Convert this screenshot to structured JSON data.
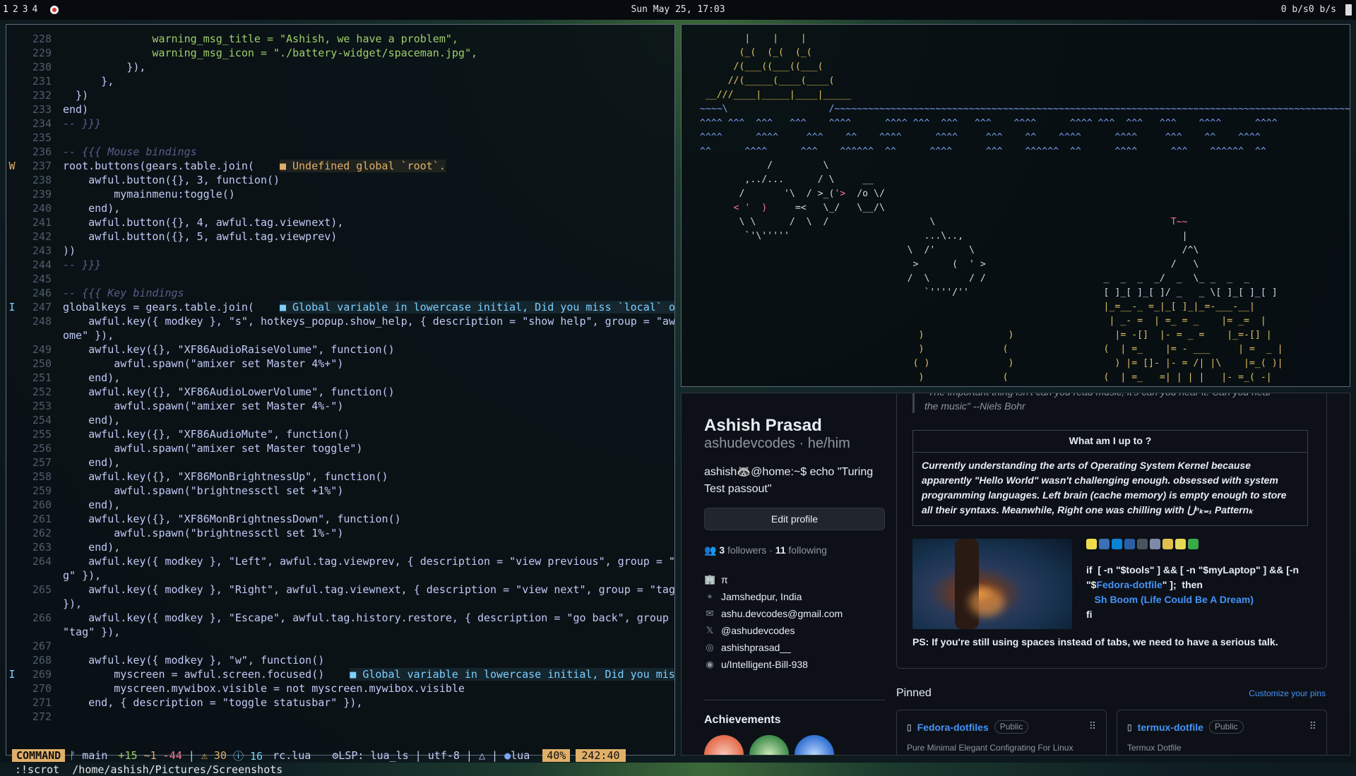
{
  "topbar": {
    "tags": [
      "1",
      "2",
      "3",
      "4"
    ],
    "clock": "Sun May 25, 17:03",
    "net": "0 b/s0 b/s"
  },
  "editor": {
    "lines": [
      {
        "n": "228",
        "sign": "",
        "t": "              warning_msg_title = \"Ashish, we have a problem\",",
        "cls": "c-str"
      },
      {
        "n": "229",
        "sign": "",
        "t": "              warning_msg_icon = \"./battery-widget/spaceman.jpg\",",
        "cls": "c-str"
      },
      {
        "n": "230",
        "sign": "",
        "t": "          }),",
        "cls": ""
      },
      {
        "n": "231",
        "sign": "",
        "t": "      },",
        "cls": ""
      },
      {
        "n": "232",
        "sign": "",
        "t": "  })",
        "cls": ""
      },
      {
        "n": "233",
        "sign": "",
        "t": "end)",
        "cls": ""
      },
      {
        "n": "234",
        "sign": "",
        "t": "-- }}}",
        "cls": "c-com"
      },
      {
        "n": "235",
        "sign": "",
        "t": "",
        "cls": ""
      },
      {
        "n": "236",
        "sign": "",
        "t": "-- {{{ Mouse bindings",
        "cls": "c-com"
      },
      {
        "n": "237",
        "sign": "W",
        "t": "root.buttons(gears.table.join(",
        "cls": "",
        "diag": "■ Undefined global `root`.",
        "dcls": "c-warn"
      },
      {
        "n": "238",
        "sign": "",
        "t": "    awful.button({}, 3, function()",
        "cls": ""
      },
      {
        "n": "239",
        "sign": "",
        "t": "        mymainmenu:toggle()",
        "cls": ""
      },
      {
        "n": "240",
        "sign": "",
        "t": "    end),",
        "cls": ""
      },
      {
        "n": "241",
        "sign": "",
        "t": "    awful.button({}, 4, awful.tag.viewnext),",
        "cls": ""
      },
      {
        "n": "242",
        "sign": "",
        "t": "    awful.button({}, 5, awful.tag.viewprev)",
        "cls": ""
      },
      {
        "n": "243",
        "sign": "",
        "t": "))",
        "cls": ""
      },
      {
        "n": "244",
        "sign": "",
        "t": "-- }}}",
        "cls": "c-com"
      },
      {
        "n": "245",
        "sign": "",
        "t": "",
        "cls": ""
      },
      {
        "n": "246",
        "sign": "",
        "t": "-- {{{ Key bindings",
        "cls": "c-com"
      },
      {
        "n": "247",
        "sign": "I",
        "t": "globalkeys = gears.table.join(",
        "cls": "",
        "diag": "■ Global variable in lowercase initial, Did you miss `local` or",
        "dcls": "c-info"
      },
      {
        "n": "248",
        "sign": "",
        "t": "    awful.key({ modkey }, \"s\", hotkeys_popup.show_help, { description = \"show help\", group = \"awes",
        "cls": ""
      },
      {
        "n": "",
        "sign": "",
        "t": "ome\" }),",
        "cls": ""
      },
      {
        "n": "249",
        "sign": "",
        "t": "    awful.key({}, \"XF86AudioRaiseVolume\", function()",
        "cls": ""
      },
      {
        "n": "250",
        "sign": "",
        "t": "        awful.spawn(\"amixer set Master 4%+\")",
        "cls": ""
      },
      {
        "n": "251",
        "sign": "",
        "t": "    end),",
        "cls": ""
      },
      {
        "n": "252",
        "sign": "",
        "t": "    awful.key({}, \"XF86AudioLowerVolume\", function()",
        "cls": ""
      },
      {
        "n": "253",
        "sign": "",
        "t": "        awful.spawn(\"amixer set Master 4%-\")",
        "cls": ""
      },
      {
        "n": "254",
        "sign": "",
        "t": "    end),",
        "cls": ""
      },
      {
        "n": "255",
        "sign": "",
        "t": "    awful.key({}, \"XF86AudioMute\", function()",
        "cls": ""
      },
      {
        "n": "256",
        "sign": "",
        "t": "        awful.spawn(\"amixer set Master toggle\")",
        "cls": ""
      },
      {
        "n": "257",
        "sign": "",
        "t": "    end),",
        "cls": ""
      },
      {
        "n": "258",
        "sign": "",
        "t": "    awful.key({}, \"XF86MonBrightnessUp\", function()",
        "cls": ""
      },
      {
        "n": "259",
        "sign": "",
        "t": "        awful.spawn(\"brightnessctl set +1%\")",
        "cls": ""
      },
      {
        "n": "260",
        "sign": "",
        "t": "    end),",
        "cls": ""
      },
      {
        "n": "261",
        "sign": "",
        "t": "    awful.key({}, \"XF86MonBrightnessDown\", function()",
        "cls": ""
      },
      {
        "n": "262",
        "sign": "",
        "t": "        awful.spawn(\"brightnessctl set 1%-\")",
        "cls": ""
      },
      {
        "n": "263",
        "sign": "",
        "t": "    end),",
        "cls": ""
      },
      {
        "n": "264",
        "sign": "",
        "t": "    awful.key({ modkey }, \"Left\", awful.tag.viewprev, { description = \"view previous\", group = \"ta",
        "cls": ""
      },
      {
        "n": "",
        "sign": "",
        "t": "g\" }),",
        "cls": ""
      },
      {
        "n": "265",
        "sign": "",
        "t": "    awful.key({ modkey }, \"Right\", awful.tag.viewnext, { description = \"view next\", group = \"tag\"",
        "cls": ""
      },
      {
        "n": "",
        "sign": "",
        "t": "}),",
        "cls": ""
      },
      {
        "n": "266",
        "sign": "",
        "t": "    awful.key({ modkey }, \"Escape\", awful.tag.history.restore, { description = \"go back\", group =",
        "cls": ""
      },
      {
        "n": "",
        "sign": "",
        "t": "\"tag\" }),",
        "cls": ""
      },
      {
        "n": "267",
        "sign": "",
        "t": "",
        "cls": ""
      },
      {
        "n": "268",
        "sign": "",
        "t": "    awful.key({ modkey }, \"w\", function()",
        "cls": ""
      },
      {
        "n": "269",
        "sign": "I",
        "t": "        myscreen = awful.screen.focused()",
        "cls": "",
        "diag": "■ Global variable in lowercase initial, Did you miss",
        "dcls": "c-info"
      },
      {
        "n": "270",
        "sign": "",
        "t": "        myscreen.mywibox.visible = not myscreen.mywibox.visible",
        "cls": ""
      },
      {
        "n": "271",
        "sign": "",
        "t": "    end, { description = \"toggle statusbar\" }),",
        "cls": ""
      },
      {
        "n": "272",
        "sign": "",
        "t": "",
        "cls": ""
      }
    ],
    "status": {
      "mode": "COMMAND",
      "branch": " main ",
      "added": "+15",
      "changed": "~1",
      "deleted": "-44",
      "warnings": "⚠ 30",
      "infos": "ⓘ 16",
      "file": "rc.lua",
      "lsp": "LSP: lua_ls",
      "encoding": "utf-8",
      "filetype": "lua",
      "percent": "40%",
      "position": "242:40"
    },
    "cmdline": ":!scrot  /home/ashish/Pictures/Screenshots"
  },
  "ascii": {
    "rows": [
      [
        [
          "a-y",
          "          |    |    |"
        ]
      ],
      [
        [
          "a-y",
          "         (_(  (_(  (_("
        ]
      ],
      [
        [
          "a-y",
          "        /(___((___((___("
        ]
      ],
      [
        [
          "a-y",
          "       //(_____(____(____("
        ]
      ],
      [
        [
          "a-y",
          "   __///____|_____|____|_____"
        ]
      ],
      [
        [
          "a-b",
          "  ~~~~\\                  /~~~~~~~~~~~~~~~~~~~~~~~~~~~~~~~~~~~~~~~~~~~~~~~~~~~~~~~~~~~~~~~~~~~~~~~~~~~~~~~~~~~~~~~~~~~~~~~~~~~~"
        ]
      ],
      [
        [
          "a-b",
          "  ^^^^ ^^^  ^^^   ^^^    ^^^^      ^^^^ ^^^  ^^^   ^^^    ^^^^      ^^^^ ^^^  ^^^   ^^^    ^^^^      ^^^^"
        ]
      ],
      [
        [
          "a-b",
          "  ^^^^      ^^^^     ^^^    ^^    ^^^^      ^^^^     ^^^    ^^    ^^^^      ^^^^     ^^^    ^^    ^^^^"
        ]
      ],
      [
        [
          "a-b",
          "  ^^      ^^^^      ^^^    ^^^^^^  ^^      ^^^^      ^^^    ^^^^^^  ^^      ^^^^      ^^^    ^^^^^^  ^^"
        ]
      ],
      [
        [
          "a-w",
          "              /         \\"
        ]
      ],
      [
        [
          "a-w",
          "          ,../...      / \\     __"
        ]
      ],
      [
        [
          "a-w",
          "         /       '\\  / >_(",
          "a-r",
          "'>"
        ],
        [
          "a-w",
          "  /o \\/"
        ]
      ],
      [
        [
          "a-r",
          "        < '  )",
          "a-w",
          "     =<   \\_/   \\__/\\"
        ]
      ],
      [
        [
          "a-w",
          "         \\ \\      /  \\  /                  \\",
          "a-r",
          "                                          T~~"
        ]
      ],
      [
        [
          "a-w",
          "          `'\\'''''                        ...\\..,                                       |"
        ]
      ],
      [
        [
          "a-w",
          "                                       \\  /'      \\                                     /^\\"
        ]
      ],
      [
        [
          "a-w",
          "                                        >      (  ' >                                 /   \\"
        ]
      ],
      [
        [
          "a-w",
          "                                       /  \\       / /                     _  _  _  _/  _  \\_ _  _  _"
        ]
      ],
      [
        [
          "a-w",
          "                                          `''''/''                        [ ]_[ ]_[ ]/ _   _ \\[ ]_[ ]_[ ]"
        ]
      ],
      [
        [
          "a-y",
          "                                                                          |_=__-_ =_|_[ ]_|_=-___-__|"
        ]
      ],
      [
        [
          "a-y",
          "                                                                           | _- =  | =_ = _    |= _=  |"
        ]
      ],
      [
        [
          "a-y",
          "                                         )               )                  |= -[]  |- = _ =    |_=-[] |"
        ]
      ],
      [
        [
          "a-y",
          "                                         )              (                 (  | =_    |= - ___     | =  _ |"
        ]
      ],
      [
        [
          "a-y",
          "                                        ( )              )                  ) |= []- |- = /| |\\    |=_( )|"
        ]
      ],
      [
        [
          "a-y",
          "                                         )              (                 (  | =_   =| | | |   |- =_( -|"
        ]
      ],
      [
        [
          "a-y",
          "                                        ( )              )                  ) |_______|__|_|_|_|__|__(_-_|"
        ]
      ]
    ]
  },
  "github": {
    "name": "Ashish Prasad",
    "login": "ashudevcodes · he/him",
    "bio": "ashish🦝@home:~$ echo \"Turing Test passout\"",
    "edit_profile": "Edit profile",
    "followers_count": "3",
    "followers_label": "followers",
    "following_count": "11",
    "following_label": "following",
    "meta": [
      {
        "icon": "building-icon",
        "glyph": "🏢",
        "text": "π"
      },
      {
        "icon": "location-icon",
        "glyph": "⌖",
        "text": "Jamshedpur, India"
      },
      {
        "icon": "mail-icon",
        "glyph": "✉",
        "text": "ashu.devcodes@gmail.com"
      },
      {
        "icon": "x-icon",
        "glyph": "𝕏",
        "text": "@ashudevcodes"
      },
      {
        "icon": "instagram-icon",
        "glyph": "◎",
        "text": "ashishprasad__"
      },
      {
        "icon": "reddit-icon",
        "glyph": "◉",
        "text": "u/Intelligent-Bill-938"
      }
    ],
    "achievements": "Achievements",
    "readme": {
      "quote_1": "\"The important thing isn't can you read music, it's can you hear it. Can you hear",
      "quote_2": "the music\" --Niels Bohr",
      "upto_title": "What am I up to ?",
      "upto_body": "Currently understanding the arts of Operating System Kernel because apparently \"Hello World\" wasn't challenging enough. obsessed with system programming languages. Left brain (cache memory) is empty enough to store all their syntaxs. Meanwhile, Right one was chilling with ⋃ⁿₖ₌₁ Patternₖ",
      "shell_1": "if  [ -n \"$tools\" ] && [ -n \"$myLaptop\" ] && [-n",
      "shell_2a": "\"$",
      "shell_2_link": "Fedora-dotfile",
      "shell_2b": "\" ];  then",
      "shell_3": "Sh Boom (Life Could Be A Dream)",
      "shell_4": "fi",
      "ps": "PS: If you're still using spaces instead of tabs, we need to have a serious talk."
    },
    "pinned": "Pinned",
    "customize": "Customize your pins",
    "pins": [
      {
        "name": "Fedora-dotfiles",
        "visibility": "Public",
        "desc": "Pure Minimal Elegant Configrating For Linux"
      },
      {
        "name": "termux-dotfile",
        "visibility": "Public",
        "desc": "Termux Dotfile"
      }
    ],
    "colors": {
      "accent": "#4493f8",
      "bg": "#0d1117"
    }
  }
}
